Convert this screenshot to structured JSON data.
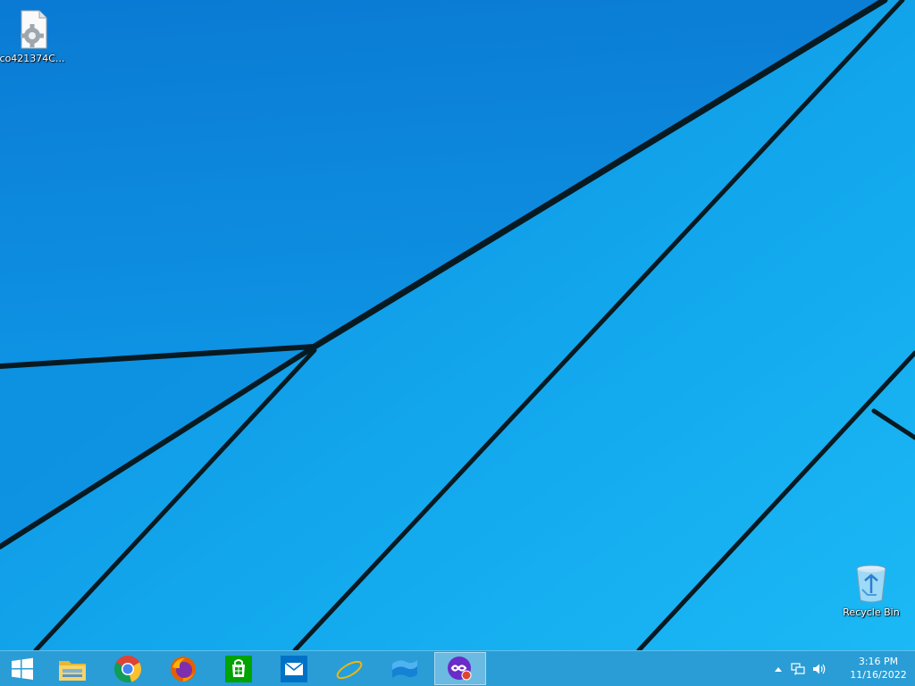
{
  "desktop": {
    "icons": [
      {
        "label": "co421374C...",
        "icon": "settings-file-icon"
      },
      {
        "label": "Recycle Bin",
        "icon": "recycle-bin-icon"
      }
    ]
  },
  "taskbar": {
    "start": {
      "icon": "windows-logo-icon"
    },
    "pinned": [
      {
        "icon": "file-explorer-icon"
      },
      {
        "icon": "chrome-icon"
      },
      {
        "icon": "firefox-icon"
      },
      {
        "icon": "store-icon"
      },
      {
        "icon": "mail-icon"
      },
      {
        "icon": "internet-explorer-icon"
      },
      {
        "icon": "blue-window-icon"
      },
      {
        "icon": "purple-app-icon",
        "active": true
      }
    ],
    "tray": {
      "show_hidden_icon": "chevron-up-icon",
      "network_icon": "network-icon",
      "volume_icon": "volume-icon",
      "time": "3:16 PM",
      "date": "11/16/2022"
    }
  },
  "colors": {
    "wallpaper_light": "#19b6f4",
    "wallpaper_dark": "#0a7fd8",
    "taskbar": "#2a9dd6"
  }
}
